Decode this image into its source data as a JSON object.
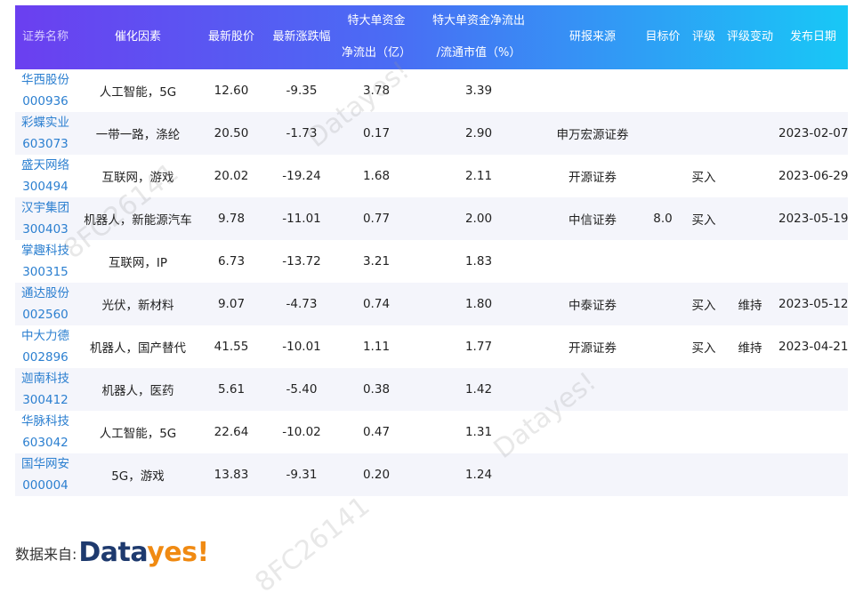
{
  "headers": {
    "code": "证券名称",
    "catalyst": "催化因素",
    "price": "最新股价",
    "change": "最新涨跌幅",
    "outflow_line1": "特大单资金",
    "outflow_line2": "净流出（亿）",
    "ratio_line1": "特大单资金净流出",
    "ratio_line2": "/流通市值（%）",
    "source": "研报来源",
    "target": "目标价",
    "rating": "评级",
    "rating_change": "评级变动",
    "date": "发布日期"
  },
  "rows": [
    {
      "name": "华西股份",
      "code": "000936",
      "catalyst": "人工智能，5G",
      "price": "12.60",
      "change": "-9.35",
      "outflow": "3.78",
      "ratio": "3.39",
      "source": "",
      "target": "",
      "rating": "",
      "rating_change": "",
      "date": ""
    },
    {
      "name": "彩蝶实业",
      "code": "603073",
      "catalyst": "一带一路，涤纶",
      "price": "20.50",
      "change": "-1.73",
      "outflow": "0.17",
      "ratio": "2.90",
      "source": "申万宏源证券",
      "target": "",
      "rating": "",
      "rating_change": "",
      "date": "2023-02-07"
    },
    {
      "name": "盛天网络",
      "code": "300494",
      "catalyst": "互联网，游戏",
      "price": "20.02",
      "change": "-19.24",
      "outflow": "1.68",
      "ratio": "2.11",
      "source": "开源证券",
      "target": "",
      "rating": "买入",
      "rating_change": "",
      "date": "2023-06-29"
    },
    {
      "name": "汉宇集团",
      "code": "300403",
      "catalyst": "机器人，新能源汽车",
      "price": "9.78",
      "change": "-11.01",
      "outflow": "0.77",
      "ratio": "2.00",
      "source": "中信证券",
      "target": "8.0",
      "rating": "买入",
      "rating_change": "",
      "date": "2023-05-19"
    },
    {
      "name": "掌趣科技",
      "code": "300315",
      "catalyst": "互联网，IP",
      "price": "6.73",
      "change": "-13.72",
      "outflow": "3.21",
      "ratio": "1.83",
      "source": "",
      "target": "",
      "rating": "",
      "rating_change": "",
      "date": ""
    },
    {
      "name": "通达股份",
      "code": "002560",
      "catalyst": "光伏，新材料",
      "price": "9.07",
      "change": "-4.73",
      "outflow": "0.74",
      "ratio": "1.80",
      "source": "中泰证券",
      "target": "",
      "rating": "买入",
      "rating_change": "维持",
      "date": "2023-05-12"
    },
    {
      "name": "中大力德",
      "code": "002896",
      "catalyst": "机器人，国产替代",
      "price": "41.55",
      "change": "-10.01",
      "outflow": "1.11",
      "ratio": "1.77",
      "source": "开源证券",
      "target": "",
      "rating": "买入",
      "rating_change": "维持",
      "date": "2023-04-21"
    },
    {
      "name": "迦南科技",
      "code": "300412",
      "catalyst": "机器人，医药",
      "price": "5.61",
      "change": "-5.40",
      "outflow": "0.38",
      "ratio": "1.42",
      "source": "",
      "target": "",
      "rating": "",
      "rating_change": "",
      "date": ""
    },
    {
      "name": "华脉科技",
      "code": "603042",
      "catalyst": "人工智能，5G",
      "price": "22.64",
      "change": "-10.02",
      "outflow": "0.47",
      "ratio": "1.31",
      "source": "",
      "target": "",
      "rating": "",
      "rating_change": "",
      "date": ""
    },
    {
      "name": "国华网安",
      "code": "000004",
      "catalyst": "5G，游戏",
      "price": "13.83",
      "change": "-9.31",
      "outflow": "0.20",
      "ratio": "1.24",
      "source": "",
      "target": "",
      "rating": "",
      "rating_change": "",
      "date": ""
    }
  ],
  "footer": {
    "label": "数据来自:",
    "logo_part1": "Data",
    "logo_part2": "yes!"
  },
  "watermarks": [
    "Datayes!",
    "8FC26141",
    "Datayes!",
    "8FC26141"
  ],
  "colors": {
    "header_start": "#6b3ff0",
    "header_end": "#18c8f6",
    "name_link": "#2b7fd0",
    "logo_dark": "#1e3a6e",
    "logo_orange": "#f08a12"
  }
}
